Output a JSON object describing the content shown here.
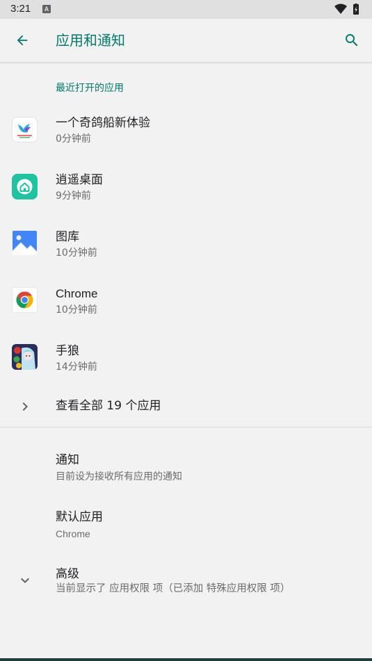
{
  "status_bar": {
    "time": "3:21",
    "notification_glyph": "A"
  },
  "app_bar": {
    "title": "应用和通知"
  },
  "recent_section": {
    "header": "最近打开的应用",
    "apps": [
      {
        "name": "一个奇鸽船新体验",
        "time": "0分钟前",
        "icon": "pigeon-app-icon"
      },
      {
        "name": "逍遥桌面",
        "time": "9分钟前",
        "icon": "launcher-home-icon"
      },
      {
        "name": "图库",
        "time": "10分钟前",
        "icon": "gallery-icon"
      },
      {
        "name": "Chrome",
        "time": "10分钟前",
        "icon": "chrome-icon"
      },
      {
        "name": "手狼",
        "time": "14分钟前",
        "icon": "game-app-icon"
      }
    ],
    "see_all": "查看全部 19 个应用"
  },
  "settings": {
    "notifications": {
      "title": "通知",
      "summary": "目前设为接收所有应用的通知"
    },
    "default_apps": {
      "title": "默认应用",
      "summary": "Chrome"
    },
    "advanced": {
      "title": "高级",
      "summary": "当前显示了 应用权限 项（已添加 特殊应用权限 项）"
    }
  },
  "colors": {
    "accent": "#00796b",
    "background": "#f2f2f2",
    "status_bar": "#e0e0e0"
  }
}
